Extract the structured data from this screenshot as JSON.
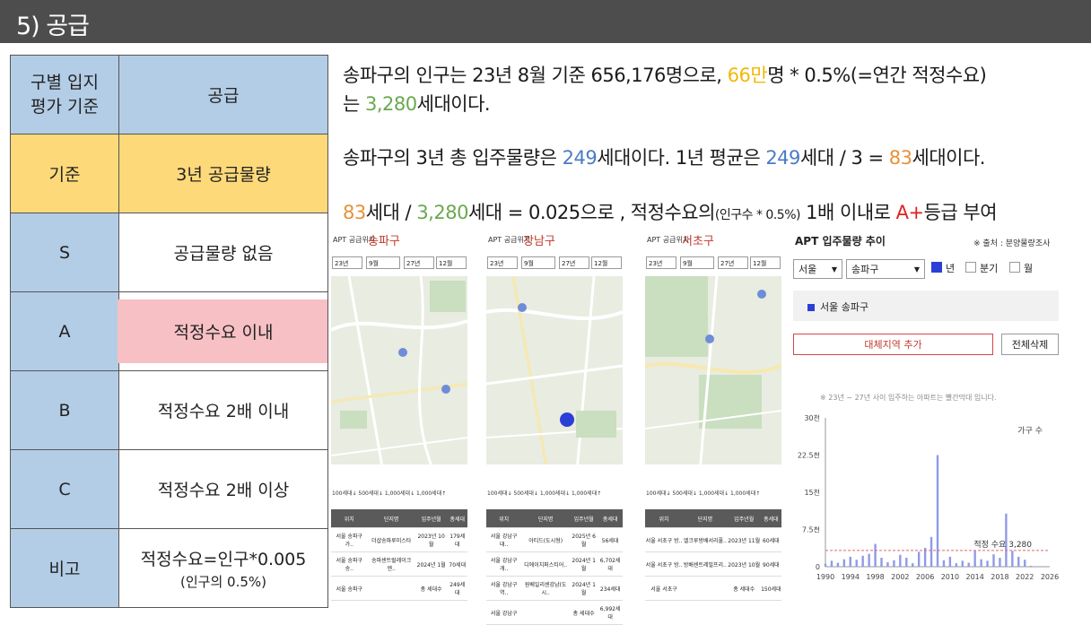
{
  "title": "5) 공급",
  "criteria_table": {
    "header": {
      "col1": "구별 입지\n평가 기준",
      "col2": "공급"
    },
    "rows": [
      {
        "label": "기준",
        "value": "3년 공급물량"
      },
      {
        "label": "S",
        "value": "공급물량 없음"
      },
      {
        "label": "A",
        "value": "적정수요 이내"
      },
      {
        "label": "B",
        "value": "적정수요 2배 이내"
      },
      {
        "label": "C",
        "value": "적정수요 2배 이상"
      },
      {
        "label": "비고",
        "value": "적정수요=인구*0.005",
        "sub": "(인구의 0.5%)"
      }
    ]
  },
  "text": {
    "l1a": "송파구의 인구는 23년 8월 기준 656,176명으로, ",
    "l1b": "66만",
    "l1c": "명 * 0.5%(=연간 적정수요)",
    "l2a": "는 ",
    "l2b": "3,280",
    "l2c": "세대이다.",
    "l3a": "송파구의 3년 총 입주물량은 ",
    "l3b": "249",
    "l3c": "세대이다. 1년 평균은 ",
    "l3d": "249",
    "l3e": "세대 / 3 = ",
    "l3f": "83",
    "l3g": "세대이다.",
    "l4a": "83",
    "l4b": "세대 / ",
    "l4c": "3,280",
    "l4d": "세대 = 0.025으로 , 적정수요의",
    "l4e": "(인구수 * 0.5%)",
    "l4f": " 1배 이내로 ",
    "l4g": "A+",
    "l4h": "등급 부여"
  },
  "panels": [
    {
      "header": "APT 공급위치",
      "district": "송파구",
      "from_year": "23년",
      "from_month": "9월",
      "to_year": "27년",
      "to_month": "12월",
      "legend": "100세대↓  500세대↓  1,000세대↓  1,000세대↑",
      "table_head": [
        "위치",
        "단지명",
        "입주년월",
        "총세대"
      ],
      "rows": [
        [
          "서울 송파구 가..",
          "더샵송파루미스타",
          "2023년 10월",
          "179세대"
        ],
        [
          "서울 송파구 송..",
          "송파센트럴레이크엔..",
          "2024년 1월",
          "70세대"
        ],
        [
          "서울 송파구",
          "",
          "총 세대수",
          "249세대"
        ]
      ]
    },
    {
      "header": "APT 공급위치",
      "district": "강남구",
      "from_year": "23년",
      "from_month": "9월",
      "to_year": "27년",
      "to_month": "12월",
      "legend": "100세대↓  500세대↓  1,000세대↓  1,000세대↑",
      "table_head": [
        "위치",
        "단지명",
        "입주년월",
        "총세대"
      ],
      "rows": [
        [
          "서울 강남구 대..",
          "아티드(도시형)",
          "2025년 6월",
          "56세대"
        ],
        [
          "서울 강남구 개..",
          "디에이치퍼스티어..",
          "2024년 1월",
          "6,702세대"
        ],
        [
          "서울 강남구 역..",
          "원베일리센강남(도시..",
          "2024년 1월",
          "234세대"
        ],
        [
          "서울 강남구",
          "",
          "총 세대수",
          "6,992세대"
        ]
      ]
    },
    {
      "header": "APT 공급위치",
      "district": "서초구",
      "from_year": "23년",
      "from_month": "9월",
      "to_year": "27년",
      "to_month": "12월",
      "legend": "100세대↓  500세대↓  1,000세대↓  1,000세대↑",
      "table_head": [
        "위치",
        "단지명",
        "입주년월",
        "총세대"
      ],
      "rows": [
        [
          "서울 서초구 방..",
          "엘크루방배서리풀..",
          "2023년 11월",
          "60세대"
        ],
        [
          "서울 서초구 방..",
          "방배센트레빌프리..",
          "2023년 10월",
          "90세대"
        ],
        [
          "서울 서초구",
          "",
          "총 세대수",
          "150세대"
        ]
      ]
    }
  ],
  "supply_panel": {
    "title": "APT 입주물량 추이",
    "source": "※ 출처 : 분양물량조사",
    "city": "서울",
    "district": "송파구",
    "opt_year": "년",
    "opt_quarter": "분기",
    "opt_month": "월",
    "selected_region": "서울 송파구",
    "btn_add": "대체지역 추가",
    "btn_delete": "전체삭제",
    "note": "※ 23년 ~ 27년 사이 입주하는 아파트는 빨간막대 입니다."
  },
  "chart_data": {
    "type": "bar",
    "title": "",
    "xlabel": "",
    "ylabel": "가구 수",
    "ylim": [
      0,
      30000
    ],
    "y_ticks": [
      "0",
      "7.5천",
      "15천",
      "22.5천",
      "30천"
    ],
    "x_ticks": [
      "1990",
      "1994",
      "1998",
      "2002",
      "2006",
      "2010",
      "2014",
      "2018",
      "2022",
      "2026"
    ],
    "reference_line": {
      "label": "적정 수요 3,280",
      "value": 3280
    },
    "x": [
      1990,
      1991,
      1992,
      1993,
      1994,
      1995,
      1996,
      1997,
      1998,
      1999,
      2000,
      2001,
      2002,
      2003,
      2004,
      2005,
      2006,
      2007,
      2008,
      2009,
      2010,
      2011,
      2012,
      2013,
      2014,
      2015,
      2016,
      2017,
      2018,
      2019,
      2020,
      2021,
      2022,
      2023,
      2024,
      2025,
      2026
    ],
    "values": [
      600,
      1200,
      800,
      1500,
      2000,
      1400,
      2200,
      2600,
      4600,
      1800,
      900,
      1300,
      2400,
      1800,
      700,
      3000,
      3800,
      6000,
      22500,
      1300,
      2000,
      700,
      1200,
      800,
      3200,
      1500,
      1200,
      2500,
      1800,
      10700,
      3200,
      2000,
      1400,
      179,
      70,
      0,
      0
    ],
    "grid": false
  }
}
